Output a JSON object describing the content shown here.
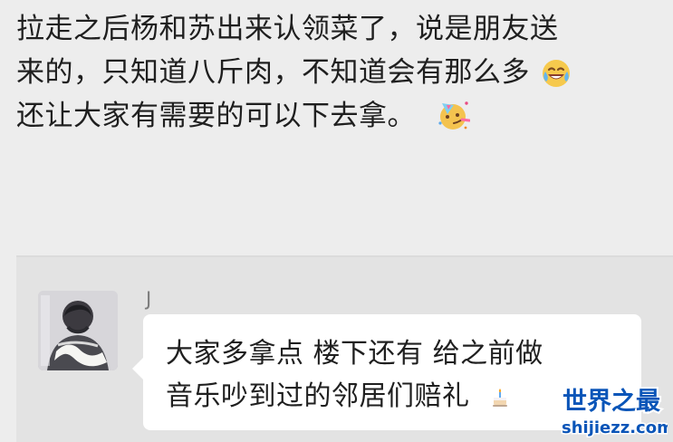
{
  "post": {
    "line1": "拉走之后杨和苏出来认领菜了，说是朋友送",
    "line2": "来的，只知道八斤肉，不知道会有那么多",
    "line3": "还让大家有需要的可以下去拿。"
  },
  "chat": {
    "sender": "J",
    "message_line1": "大家多拿点 楼下还有 给之前做",
    "message_line2": "音乐吵到过的邻居们赔礼"
  },
  "watermark": {
    "title": "世界之最",
    "domain": "shijiezz.com"
  },
  "colors": {
    "page_background": "#ededed",
    "chat_panel_background": "#e3e3e3",
    "bubble_background": "#ffffff",
    "text": "#1f1f1f",
    "sender": "#7c7c7c",
    "watermark_blue": "#0a55b8"
  },
  "icons": {
    "laughing_emoji": "laughing-crying-emoji-icon",
    "party_emoji": "partying-face-emoji-icon",
    "cake_emoji": "birthday-cake-emoji-icon"
  }
}
